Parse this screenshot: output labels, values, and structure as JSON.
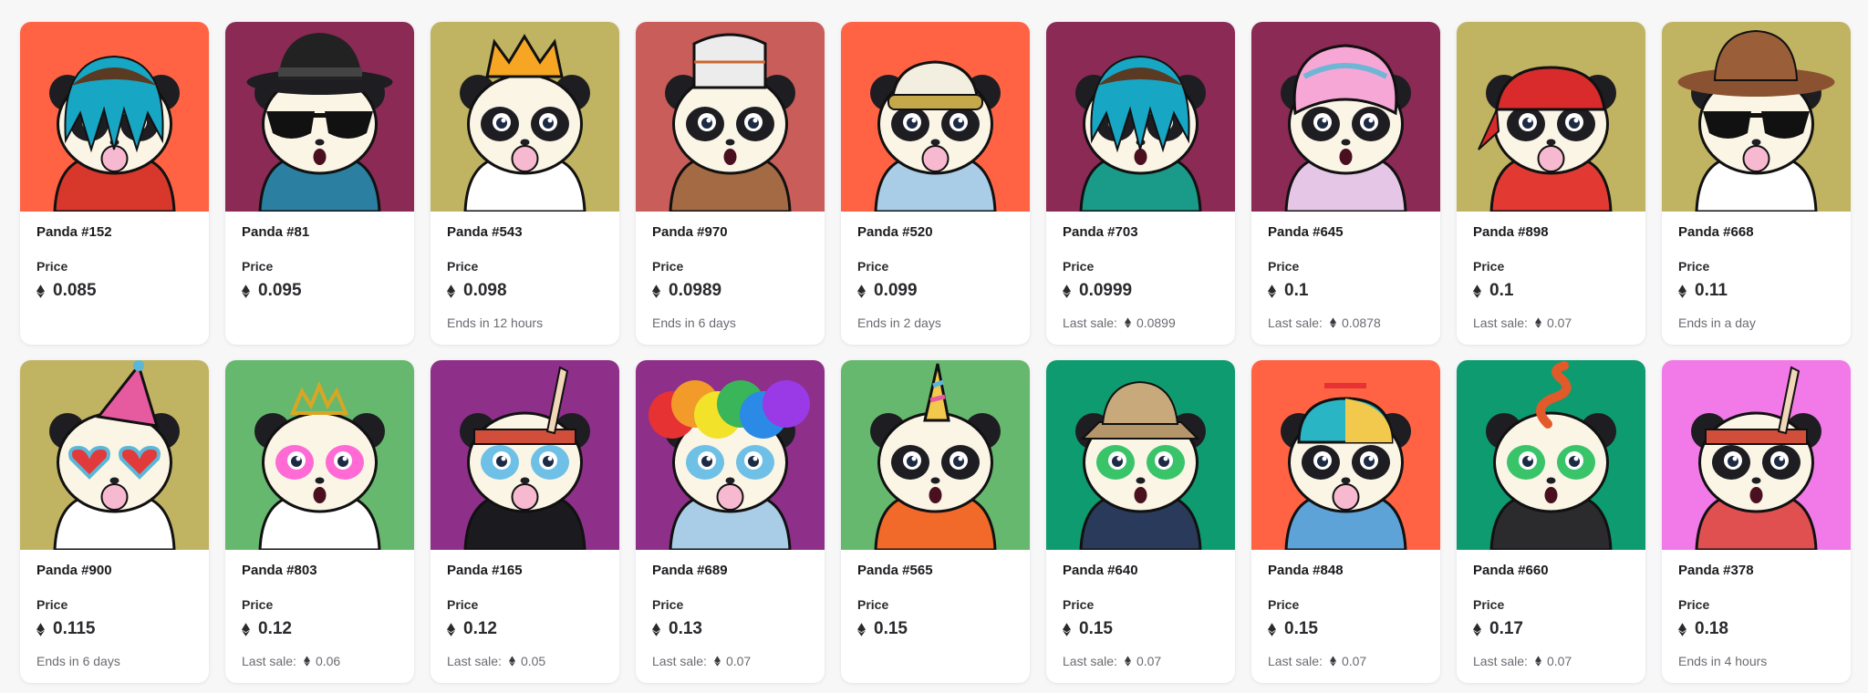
{
  "cards": [
    {
      "title": "Panda #152",
      "price_label": "Price",
      "price": "0.085",
      "footer_type": "none",
      "footer_text": "",
      "footer_value": "",
      "art": {
        "bg": "#ff6343",
        "hat": "dreads",
        "eyes": "normal",
        "bubble": true,
        "shirt": "#d8382c"
      }
    },
    {
      "title": "Panda #81",
      "price_label": "Price",
      "price": "0.095",
      "footer_type": "none",
      "footer_text": "",
      "footer_value": "",
      "art": {
        "bg": "#8a2a55",
        "hat": "fedora",
        "eyes": "shades",
        "bubble": false,
        "shirt": "#2b7fa0"
      }
    },
    {
      "title": "Panda #543",
      "price_label": "Price",
      "price": "0.098",
      "footer_type": "text",
      "footer_text": "Ends in 12 hours",
      "footer_value": "",
      "art": {
        "bg": "#c0b462",
        "hat": "crown",
        "eyes": "normal",
        "bubble": true,
        "shirt": "#ffffff"
      }
    },
    {
      "title": "Panda #970",
      "price_label": "Price",
      "price": "0.0989",
      "footer_type": "text",
      "footer_text": "Ends in 6 days",
      "footer_value": "",
      "art": {
        "bg": "#c95d5a",
        "hat": "chef",
        "eyes": "normal",
        "bubble": false,
        "shirt": "#a46a43"
      }
    },
    {
      "title": "Panda #520",
      "price_label": "Price",
      "price": "0.099",
      "footer_type": "text",
      "footer_text": "Ends in 2 days",
      "footer_value": "",
      "art": {
        "bg": "#ff6343",
        "hat": "visor",
        "eyes": "normal",
        "bubble": true,
        "shirt": "#a9cde6"
      }
    },
    {
      "title": "Panda #703",
      "price_label": "Price",
      "price": "0.0999",
      "footer_type": "sale",
      "footer_text": "Last sale:",
      "footer_value": "0.0899",
      "art": {
        "bg": "#8a2a55",
        "hat": "dreads",
        "eyes": "normal",
        "bubble": false,
        "shirt": "#1a9b8a"
      }
    },
    {
      "title": "Panda #645",
      "price_label": "Price",
      "price": "0.1",
      "footer_type": "sale",
      "footer_text": "Last sale:",
      "footer_value": "0.0878",
      "art": {
        "bg": "#8a2a55",
        "hat": "bonnet",
        "eyes": "normal",
        "bubble": false,
        "shirt": "#e6c6e6"
      }
    },
    {
      "title": "Panda #898",
      "price_label": "Price",
      "price": "0.1",
      "footer_type": "sale",
      "footer_text": "Last sale:",
      "footer_value": "0.07",
      "art": {
        "bg": "#c0b462",
        "hat": "bandana",
        "eyes": "normal",
        "bubble": true,
        "shirt": "#e23a33"
      }
    },
    {
      "title": "Panda #668",
      "price_label": "Price",
      "price": "0.11",
      "footer_type": "text",
      "footer_text": "Ends in a day",
      "footer_value": "",
      "art": {
        "bg": "#c0b462",
        "hat": "cowboy",
        "eyes": "shades",
        "bubble": true,
        "shirt": "#ffffff"
      }
    },
    {
      "title": "Panda #900",
      "price_label": "Price",
      "price": "0.115",
      "footer_type": "text",
      "footer_text": "Ends in 6 days",
      "footer_value": "",
      "art": {
        "bg": "#c0b462",
        "hat": "party",
        "eyes": "hearts",
        "bubble": true,
        "shirt": "#ffffff"
      }
    },
    {
      "title": "Panda #803",
      "price_label": "Price",
      "price": "0.12",
      "footer_type": "sale",
      "footer_text": "Last sale:",
      "footer_value": "0.06",
      "art": {
        "bg": "#66b86e",
        "hat": "tiara",
        "eyes": "pink",
        "bubble": false,
        "shirt": "#ffffff"
      }
    },
    {
      "title": "Panda #165",
      "price_label": "Price",
      "price": "0.12",
      "footer_type": "sale",
      "footer_text": "Last sale:",
      "footer_value": "0.05",
      "art": {
        "bg": "#8e2f8a",
        "hat": "feather",
        "eyes": "rainbow",
        "bubble": true,
        "shirt": "#1b1b1f"
      }
    },
    {
      "title": "Panda #689",
      "price_label": "Price",
      "price": "0.13",
      "footer_type": "sale",
      "footer_text": "Last sale:",
      "footer_value": "0.07",
      "art": {
        "bg": "#8e2f8a",
        "hat": "afro",
        "eyes": "rainbow",
        "bubble": true,
        "shirt": "#a9cde6"
      }
    },
    {
      "title": "Panda #565",
      "price_label": "Price",
      "price": "0.15",
      "footer_type": "none",
      "footer_text": "",
      "footer_value": "",
      "art": {
        "bg": "#66b86e",
        "hat": "unicorn",
        "eyes": "normal",
        "bubble": false,
        "shirt": "#f26a2a"
      }
    },
    {
      "title": "Panda #640",
      "price_label": "Price",
      "price": "0.15",
      "footer_type": "sale",
      "footer_text": "Last sale:",
      "footer_value": "0.07",
      "art": {
        "bg": "#0e9b6f",
        "hat": "bucket",
        "eyes": "green",
        "bubble": false,
        "shirt": "#2a3a5a"
      }
    },
    {
      "title": "Panda #848",
      "price_label": "Price",
      "price": "0.15",
      "footer_type": "sale",
      "footer_text": "Last sale:",
      "footer_value": "0.07",
      "art": {
        "bg": "#ff6343",
        "hat": "propeller",
        "eyes": "normal",
        "bubble": true,
        "shirt": "#5ea3d8"
      }
    },
    {
      "title": "Panda #660",
      "price_label": "Price",
      "price": "0.17",
      "footer_type": "sale",
      "footer_text": "Last sale:",
      "footer_value": "0.07",
      "art": {
        "bg": "#0e9b6f",
        "hat": "snake",
        "eyes": "green",
        "bubble": false,
        "shirt": "#2b2b2e"
      }
    },
    {
      "title": "Panda #378",
      "price_label": "Price",
      "price": "0.18",
      "footer_type": "text",
      "footer_text": "Ends in 4 hours",
      "footer_value": "",
      "art": {
        "bg": "#f27ae8",
        "hat": "feather",
        "eyes": "normal",
        "bubble": false,
        "shirt": "#e05050"
      }
    }
  ]
}
